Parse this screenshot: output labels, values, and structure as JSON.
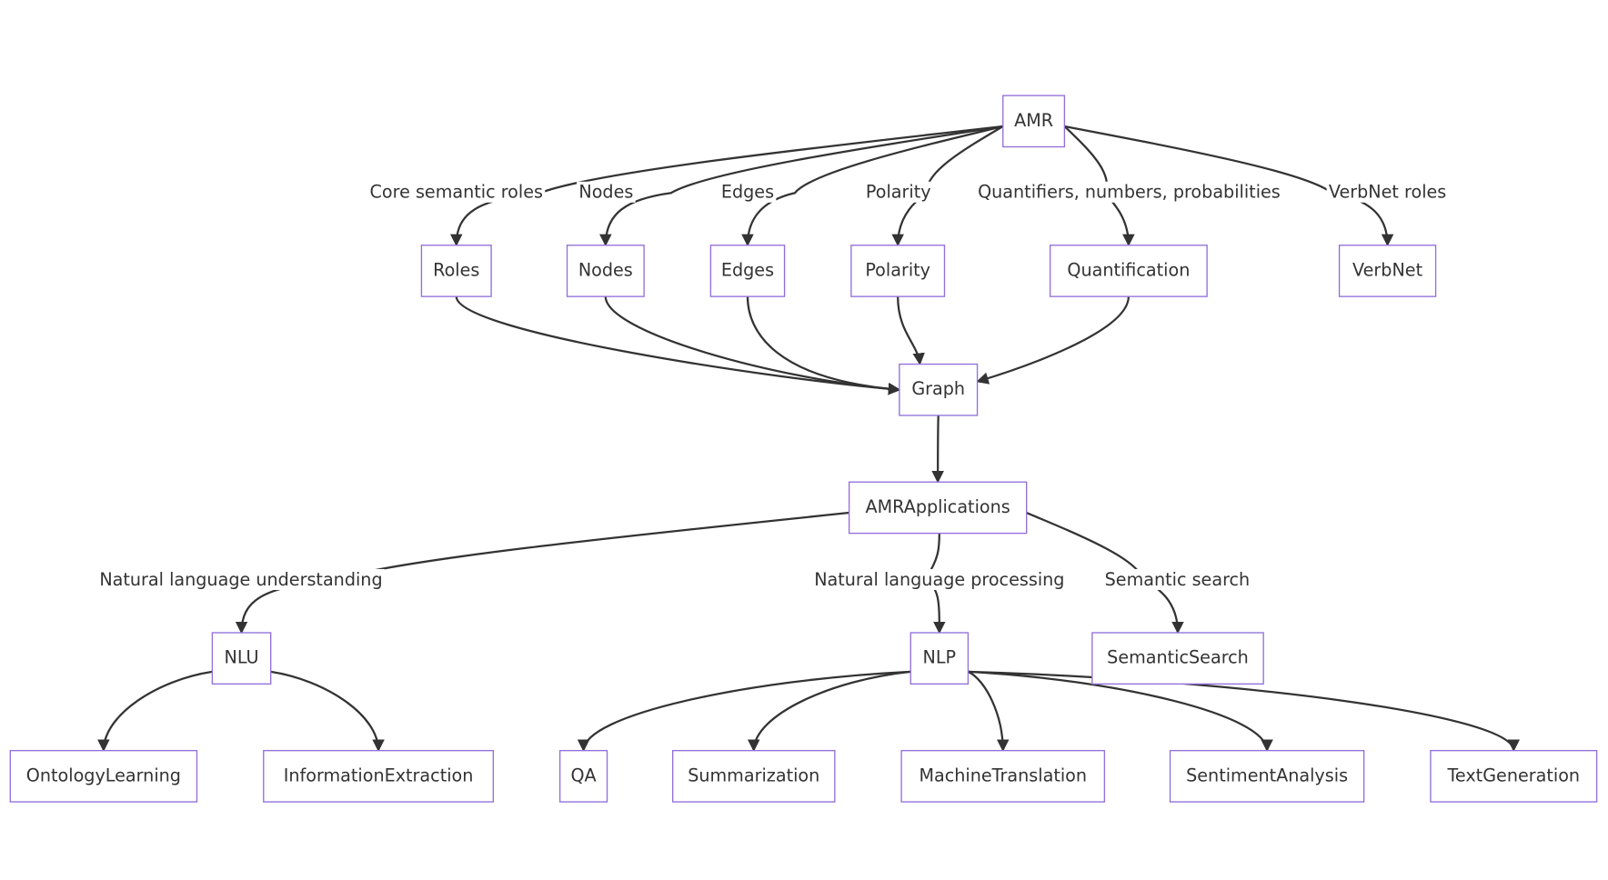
{
  "colors": {
    "node_border": "#9370DB",
    "node_fill": "#ffffff",
    "edge": "#333333",
    "text": "#333333"
  },
  "nodes": {
    "AMR": "AMR",
    "Roles": "Roles",
    "Nodes": "Nodes",
    "Edges": "Edges",
    "Polarity": "Polarity",
    "Quantification": "Quantification",
    "VerbNet": "VerbNet",
    "Graph": "Graph",
    "AMRApplications": "AMRApplications",
    "NLU": "NLU",
    "NLP": "NLP",
    "SemanticSearch": "SemanticSearch",
    "OntologyLearning": "OntologyLearning",
    "InformationExtraction": "InformationExtraction",
    "QA": "QA",
    "Summarization": "Summarization",
    "MachineTranslation": "MachineTranslation",
    "SentimentAnalysis": "SentimentAnalysis",
    "TextGeneration": "TextGeneration"
  },
  "edges": [
    {
      "from": "AMR",
      "to": "Roles",
      "label": "Core semantic roles"
    },
    {
      "from": "AMR",
      "to": "Nodes",
      "label": "Nodes"
    },
    {
      "from": "AMR",
      "to": "Edges",
      "label": "Edges"
    },
    {
      "from": "AMR",
      "to": "Polarity",
      "label": "Polarity"
    },
    {
      "from": "AMR",
      "to": "Quantification",
      "label": "Quantifiers, numbers, probabilities"
    },
    {
      "from": "AMR",
      "to": "VerbNet",
      "label": "VerbNet roles"
    },
    {
      "from": "Roles",
      "to": "Graph",
      "label": ""
    },
    {
      "from": "Nodes",
      "to": "Graph",
      "label": ""
    },
    {
      "from": "Edges",
      "to": "Graph",
      "label": ""
    },
    {
      "from": "Polarity",
      "to": "Graph",
      "label": ""
    },
    {
      "from": "Quantification",
      "to": "Graph",
      "label": ""
    },
    {
      "from": "Graph",
      "to": "AMRApplications",
      "label": ""
    },
    {
      "from": "AMRApplications",
      "to": "NLU",
      "label": "Natural language understanding"
    },
    {
      "from": "AMRApplications",
      "to": "NLP",
      "label": "Natural language processing"
    },
    {
      "from": "AMRApplications",
      "to": "SemanticSearch",
      "label": "Semantic search"
    },
    {
      "from": "NLU",
      "to": "OntologyLearning",
      "label": ""
    },
    {
      "from": "NLU",
      "to": "InformationExtraction",
      "label": ""
    },
    {
      "from": "NLP",
      "to": "QA",
      "label": ""
    },
    {
      "from": "NLP",
      "to": "Summarization",
      "label": ""
    },
    {
      "from": "NLP",
      "to": "MachineTranslation",
      "label": ""
    },
    {
      "from": "NLP",
      "to": "SentimentAnalysis",
      "label": ""
    },
    {
      "from": "NLP",
      "to": "TextGeneration",
      "label": ""
    }
  ]
}
